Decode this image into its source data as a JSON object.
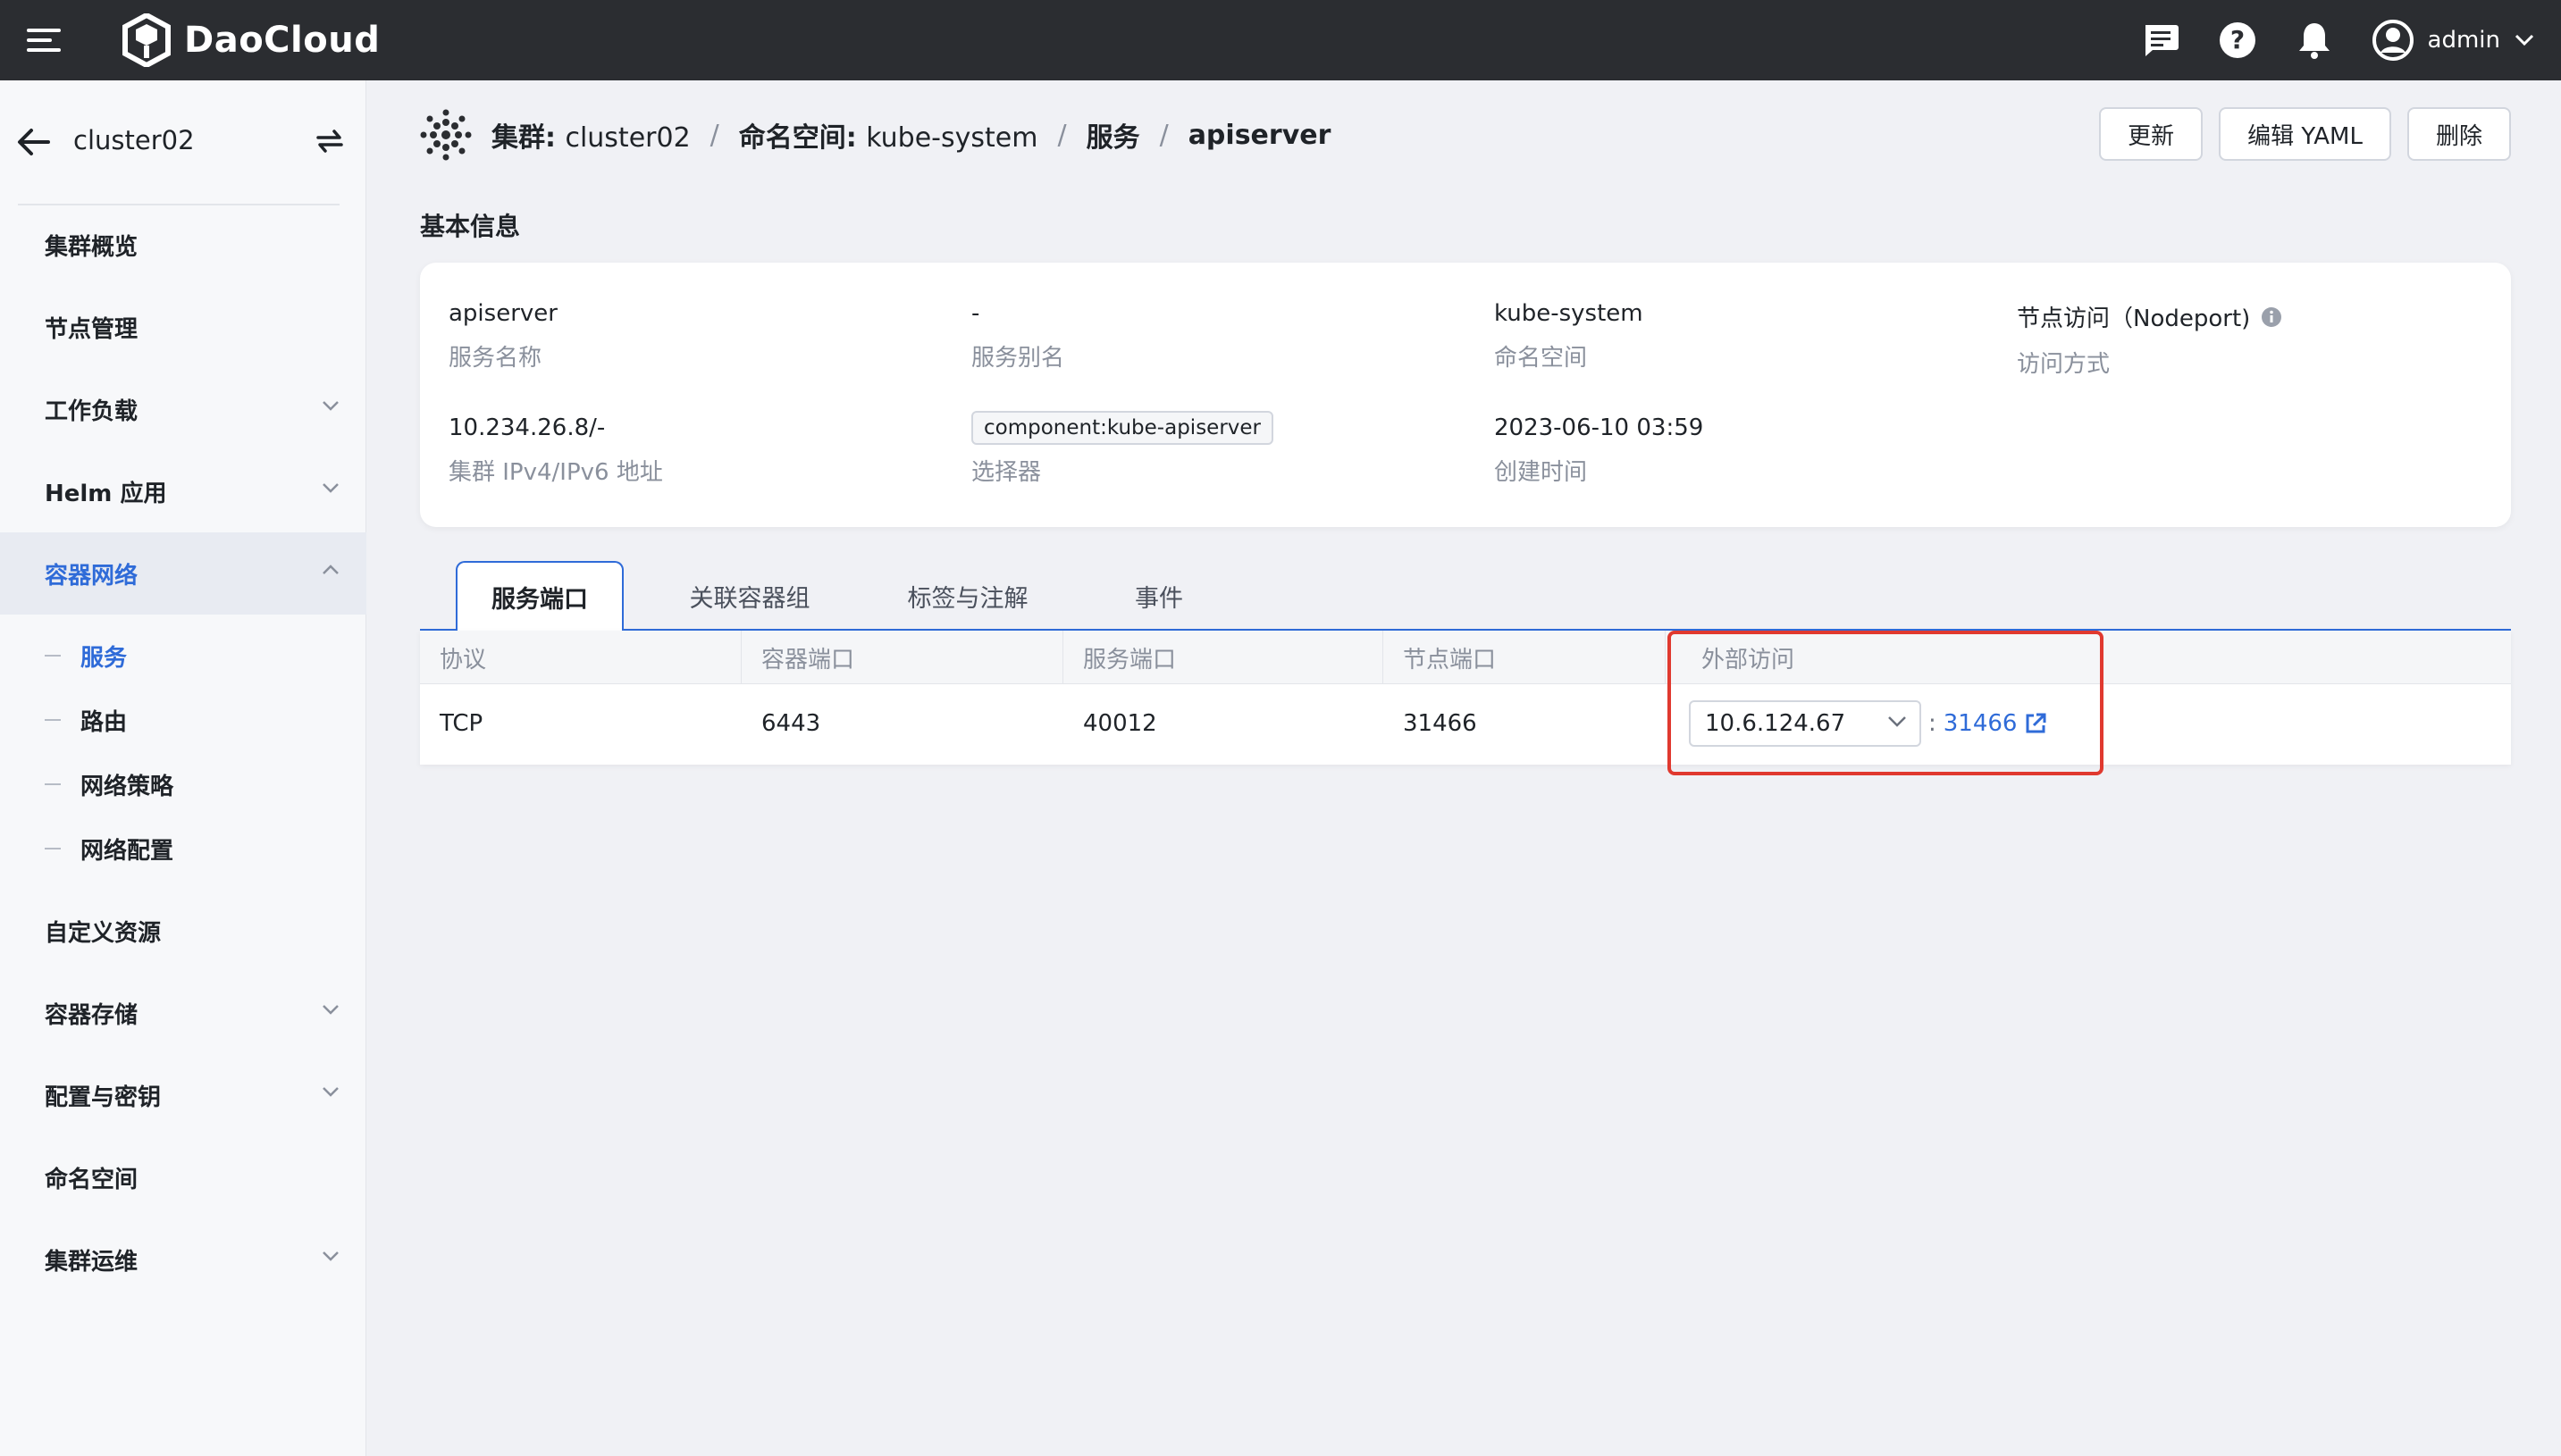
{
  "topbar": {
    "logo_text": "DaoCloud",
    "user_name": "admin",
    "icons": [
      "menu-icon",
      "message-icon",
      "help-icon",
      "bell-icon",
      "user-avatar-icon",
      "chevron-down-icon"
    ]
  },
  "sidebar": {
    "cluster_name": "cluster02",
    "items": [
      {
        "label": "集群概览",
        "expandable": false
      },
      {
        "label": "节点管理",
        "expandable": false
      },
      {
        "label": "工作负载",
        "expandable": true
      },
      {
        "label": "Helm 应用",
        "expandable": true
      },
      {
        "label": "容器网络",
        "expandable": true,
        "expanded": true,
        "active": true
      },
      {
        "label": "自定义资源",
        "expandable": false
      },
      {
        "label": "容器存储",
        "expandable": true
      },
      {
        "label": "配置与密钥",
        "expandable": true
      },
      {
        "label": "命名空间",
        "expandable": false
      },
      {
        "label": "集群运维",
        "expandable": true
      }
    ],
    "sub_items": [
      {
        "label": "服务",
        "active": true
      },
      {
        "label": "路由"
      },
      {
        "label": "网络策略"
      },
      {
        "label": "网络配置"
      }
    ]
  },
  "breadcrumb": {
    "cluster_label": "集群:",
    "cluster": "cluster02",
    "namespace_label": "命名空间:",
    "namespace": "kube-system",
    "section": "服务",
    "current": "apiserver",
    "separator": "/"
  },
  "actions": {
    "update": "更新",
    "edit_yaml": "编辑 YAML",
    "delete": "删除"
  },
  "basic_info": {
    "title": "基本信息",
    "fields": [
      {
        "value": "apiserver",
        "label": "服务名称"
      },
      {
        "value": "-",
        "label": "服务别名"
      },
      {
        "value": "kube-system",
        "label": "命名空间"
      },
      {
        "value": "节点访问（Nodeport)",
        "label": "访问方式"
      },
      {
        "value": "10.234.26.8/-",
        "label": "集群 IPv4/IPv6 地址"
      },
      {
        "value": "component:kube-apiserver",
        "label": "选择器"
      },
      {
        "value": "2023-06-10 03:59",
        "label": "创建时间"
      }
    ]
  },
  "tabs": [
    {
      "label": "服务端口",
      "active": true
    },
    {
      "label": "关联容器组"
    },
    {
      "label": "标签与注解"
    },
    {
      "label": "事件"
    }
  ],
  "ports_table": {
    "headers": [
      "协议",
      "容器端口",
      "服务端口",
      "节点端口",
      "外部访问"
    ],
    "rows": [
      {
        "protocol": "TCP",
        "container_port": "6443",
        "service_port": "40012",
        "node_port": "31466",
        "external_ip": "10.6.124.67",
        "external_sep": ":",
        "external_port": "31466"
      }
    ]
  },
  "colors": {
    "accent": "#2f6bd8",
    "highlight": "#e0392f",
    "topbar": "#2b2d31"
  }
}
